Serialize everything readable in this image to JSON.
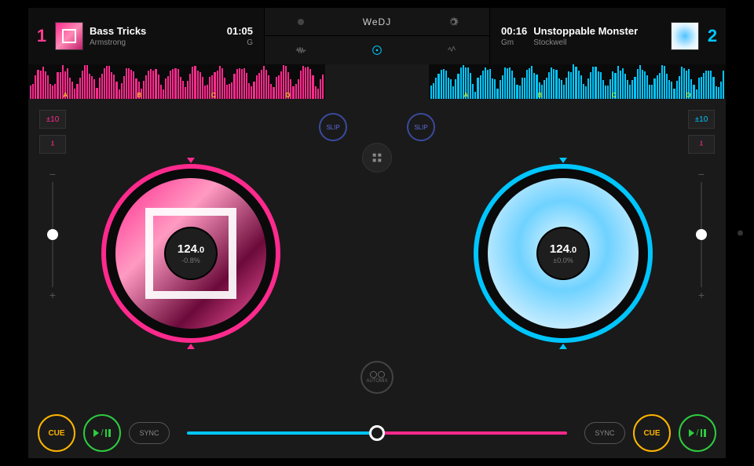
{
  "brand": "WeDJ",
  "deck1": {
    "number": "1",
    "title": "Bass Tricks",
    "artist": "Armstrong",
    "time": "01:05",
    "key": "G",
    "bpm_int": "124",
    "bpm_dec": ".0",
    "pitch": "-0.8%",
    "tempo_range": "±10",
    "slip": "SLIP"
  },
  "deck2": {
    "number": "2",
    "title": "Unstoppable Monster",
    "artist": "Stockwell",
    "time": "00:16",
    "key": "Gm",
    "bpm_int": "124",
    "bpm_dec": ".0",
    "pitch": "±0.0%",
    "tempo_range": "±10",
    "slip": "SLIP"
  },
  "transport": {
    "cue": "CUE",
    "sync": "SYNC"
  },
  "automix": "AUTOMIX",
  "markers": {
    "a": "A",
    "b": "B",
    "c": "C",
    "d": "D"
  },
  "icons": {
    "record": "record-icon",
    "settings": "gear-icon",
    "wave": "waveform-icon",
    "disc": "disc-icon",
    "fx": "fx-icon",
    "keylock": "keylock-icon",
    "browse": "browse-icon"
  },
  "signs": {
    "minus": "−",
    "plus": "+"
  }
}
